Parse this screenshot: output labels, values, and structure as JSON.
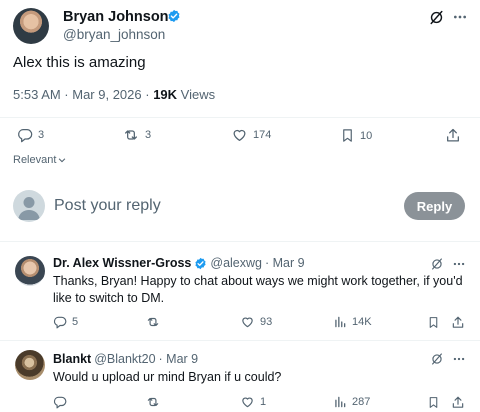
{
  "main_post": {
    "author_name": "Bryan Johnson",
    "author_handle": "@bryan_johnson",
    "text": "Alex this is amazing",
    "time": "5:53 AM · Mar 9, 2026 · ",
    "views_count": "19K",
    "views_label": " Views",
    "stats": {
      "replies": "3",
      "reposts": "3",
      "likes": "174",
      "bookmarks": "10"
    }
  },
  "sort_label": "Relevant",
  "composer": {
    "placeholder": "Post your reply",
    "button_label": "Reply"
  },
  "replies": [
    {
      "name": "Dr. Alex Wissner-Gross",
      "handle": "@alexwg",
      "date": "· Mar 9",
      "text": "Thanks, Bryan! Happy to chat about ways we might work together, if you'd like to switch to DM.",
      "stats": {
        "replies": "5",
        "reposts": "",
        "likes": "93",
        "views": "14K"
      }
    },
    {
      "name": "Blankt",
      "handle": "@Blankt20",
      "date": "· Mar 9",
      "text": "Would u upload ur mind Bryan if u could?",
      "stats": {
        "replies": "",
        "reposts": "",
        "likes": "1",
        "views": "287"
      }
    }
  ],
  "colors": {
    "verified_blue": "#1d9bf0",
    "text_primary": "#0f1419",
    "text_secondary": "#536471",
    "reply_button": "#8b9298"
  }
}
